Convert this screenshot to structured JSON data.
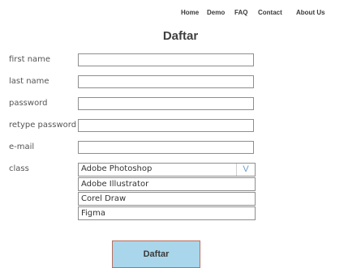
{
  "nav": {
    "items": [
      "Home",
      "Demo",
      "FAQ",
      "Contact",
      "About Us"
    ]
  },
  "form": {
    "title": "Daftar",
    "fields": [
      {
        "label": "first name",
        "value": ""
      },
      {
        "label": "last name",
        "value": ""
      },
      {
        "label": "password",
        "value": ""
      },
      {
        "label": "retype password",
        "value": ""
      },
      {
        "label": "e-mail",
        "value": ""
      }
    ],
    "class_label": "class",
    "class_select": {
      "selected": "Adobe Photoshop",
      "arrow": "V",
      "options": [
        "Adobe Illustrator",
        "Corel Draw",
        "Figma"
      ]
    },
    "submit_label": "Daftar"
  }
}
